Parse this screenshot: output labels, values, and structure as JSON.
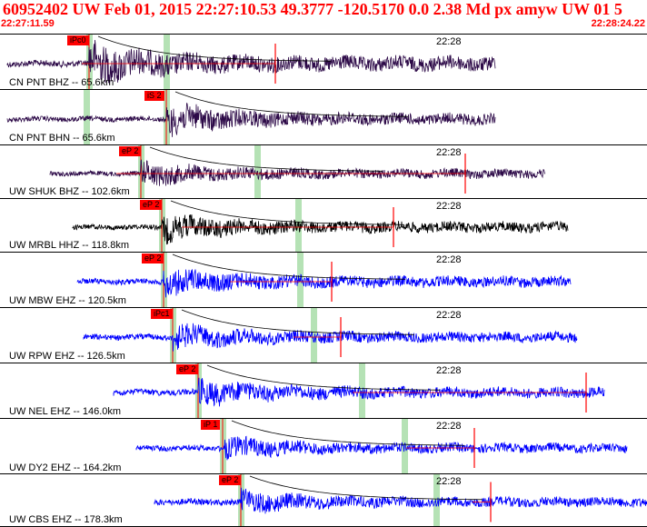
{
  "header": {
    "title": "60952402 UW Feb 01, 2015 22:27:10.53   49.3777 -120.5170  0.0 2.38 Md px amyw UW 01   5",
    "time_start": "22:27:11.59",
    "time_end": "22:28:24.22"
  },
  "colors": {
    "header": "#ff0000",
    "pick": "#ff0000",
    "window": "#b5e2b5"
  },
  "panels": [
    {
      "label": "CN PNT BHZ -- 65.6km",
      "time_tick": "22:28",
      "pick_label": "iPc0",
      "wave_color": "#2d0a48"
    },
    {
      "label": "CN PNT BHN -- 65.6km",
      "time_tick": "",
      "pick_label": "iS 2",
      "wave_color": "#2d0a48"
    },
    {
      "label": "UW SHUK BHZ -- 102.6km",
      "time_tick": "22:28",
      "pick_label": "eP 2",
      "wave_color": "#2d0a48"
    },
    {
      "label": "UW MRBL HHZ -- 118.8km",
      "time_tick": "22:28",
      "pick_label": "eP 2",
      "wave_color": "#000000"
    },
    {
      "label": "UW MBW EHZ -- 120.5km",
      "time_tick": "22:28",
      "pick_label": "eP 2",
      "wave_color": "#0000ff"
    },
    {
      "label": "UW RPW EHZ -- 126.5km",
      "time_tick": "22:28",
      "pick_label": "iPc1",
      "wave_color": "#0000ff"
    },
    {
      "label": "UW NEL EHZ -- 146.0km",
      "time_tick": "22:28",
      "pick_label": "eP 2",
      "wave_color": "#0000ff"
    },
    {
      "label": "UW DY2 EHZ -- 164.2km",
      "time_tick": "22:28",
      "pick_label": "iP 1",
      "wave_color": "#0000ff"
    },
    {
      "label": "UW CBS EHZ -- 178.3km",
      "time_tick": "22:28",
      "pick_label": "eP 2",
      "wave_color": "#0000ff"
    }
  ]
}
